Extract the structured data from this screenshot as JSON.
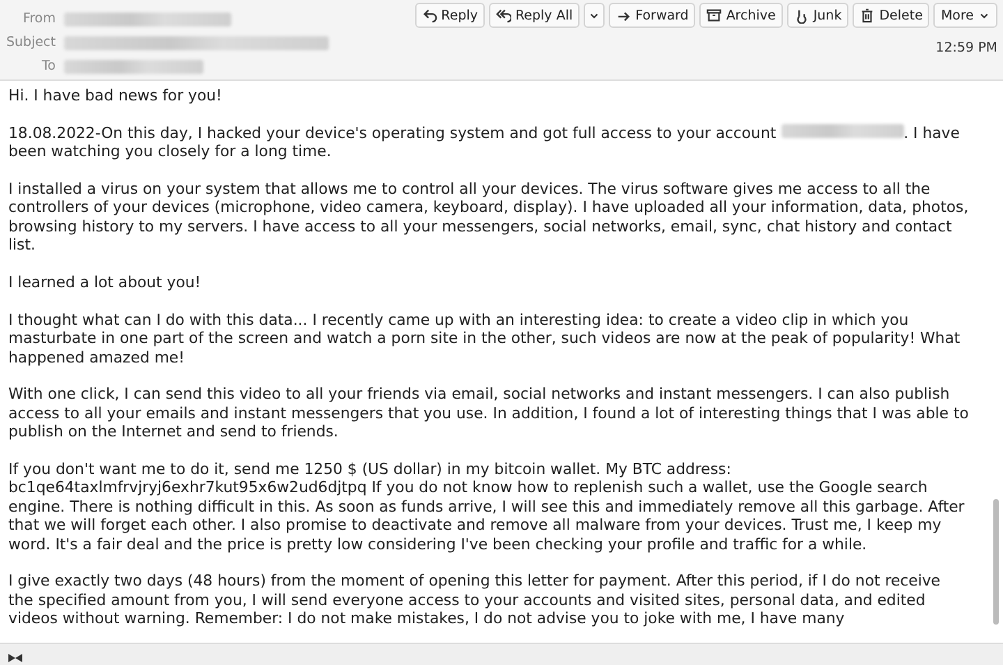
{
  "header": {
    "fields": [
      {
        "label": "From"
      },
      {
        "label": "Subject"
      },
      {
        "label": "To"
      }
    ],
    "buttons": [
      {
        "label": "Reply"
      },
      {
        "label": "Reply All"
      },
      {
        "label": "Forward"
      },
      {
        "label": "Archive"
      },
      {
        "label": "Junk"
      },
      {
        "label": "Delete"
      },
      {
        "label": "More"
      }
    ],
    "time": "12:59 PM"
  },
  "body": {
    "paragraphs": [
      {
        "text": "Hi. I have bad news for you!"
      },
      {
        "text": "18.08.2022-On this day, I hacked your device's operating system and got full access to your account",
        "redacted": true,
        "text_after": ". I have been watching you closely for a long time."
      },
      {
        "text": "I installed a virus on your system that allows me to control all your devices. The virus software gives me access to all the controllers of your devices (microphone, video camera, keyboard, display). I have uploaded all your information, data, photos, browsing history to my servers. I have access to all your messengers, social networks, email, sync, chat history and contact list."
      },
      {
        "text": "I learned a lot about you!"
      },
      {
        "text": "I thought what can I do with this data... I recently came up with an interesting idea: to create a video clip in which you masturbate in one part of the screen and watch a porn site in the other, such videos are now at the peak of popularity! What happened amazed me!"
      },
      {
        "text": "With one click, I can send this video to all your friends via email, social networks and instant messengers. I can also publish access to all your emails and instant messengers that you use. In addition, I found a lot of interesting things that I was able to publish on the Internet and send to friends."
      },
      {
        "text": "If you don't want me to do it, send me 1250 $ (US dollar) in my bitcoin wallet. My BTC address: bc1qe64taxlmfrvjryj6exhr7kut95x6w2ud6djtpq If you do not know how to replenish such a wallet, use the Google search engine. There is nothing difficult in this. As soon as funds arrive, I will see this and immediately remove all this garbage. After that we will forget each other. I also promise to deactivate and remove all malware from your devices. Trust me, I keep my word. It's a fair deal and the price is pretty low considering I've been checking your profile and traffic for a while."
      },
      {
        "text": "I give exactly two days (48 hours) from the moment of opening this letter for payment. After this period, if I do not receive the specified amount from you, I will send everyone access to your accounts and visited sites, personal data, and edited videos without warning. Remember: I do not make mistakes, I do not advise you to joke with me, I have many"
      }
    ]
  }
}
